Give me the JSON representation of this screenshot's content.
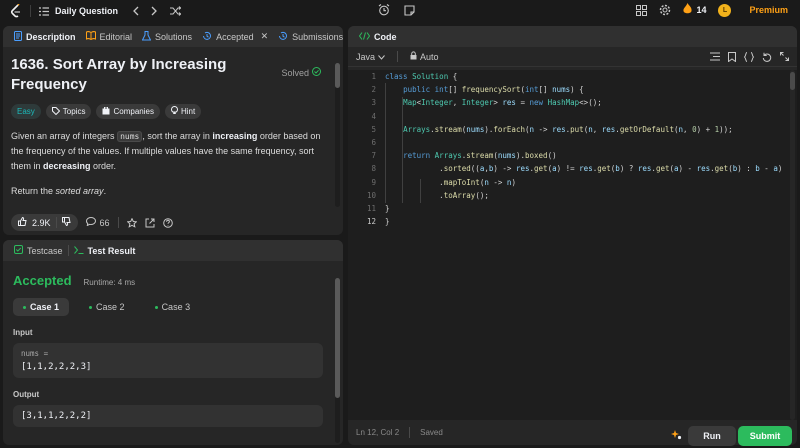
{
  "topbar": {
    "title": "Daily Question",
    "streak": "14",
    "premium": "Premium",
    "coin": "L"
  },
  "desc_tabs": [
    {
      "label": "Description",
      "icon": "description-icon"
    },
    {
      "label": "Editorial",
      "icon": "book-icon"
    },
    {
      "label": "Solutions",
      "icon": "flask-icon"
    },
    {
      "label": "Accepted",
      "icon": "history-icon"
    },
    {
      "label": "Submissions",
      "icon": "history-icon"
    }
  ],
  "problem": {
    "title": "1636. Sort Array by Increasing Frequency",
    "status": "Solved",
    "difficulty": "Easy",
    "tags": [
      "Topics",
      "Companies",
      "Hint"
    ],
    "p1_a": "Given an array of integers ",
    "p1_code": "nums",
    "p1_b": ", sort the array in ",
    "p1_bold1": "increasing",
    "p1_c": " order based on the frequency of the values. If multiple values have the same frequency, sort them in ",
    "p1_bold2": "decreasing",
    "p1_d": " order.",
    "p2_a": "Return the ",
    "p2_i": "sorted array",
    "p2_b": ".",
    "likes": "2.9K",
    "comments": "66"
  },
  "result_tabs": [
    {
      "label": "Testcase"
    },
    {
      "label": "Test Result"
    }
  ],
  "result": {
    "status": "Accepted",
    "runtime": "Runtime: 4 ms",
    "cases": [
      "Case 1",
      "Case 2",
      "Case 3"
    ],
    "input_label": "Input",
    "input_key": "nums =",
    "input_value": "[1,1,2,2,2,3]",
    "output_label": "Output",
    "output_value": "[3,1,1,2,2,2]"
  },
  "code": {
    "tab": "Code",
    "language": "Java",
    "mode": "Auto",
    "status_pos": "Ln 12, Col 2",
    "status_saved": "Saved",
    "run": "Run",
    "submit": "Submit"
  },
  "colors": {
    "accent_green": "#2cbb5d",
    "premium_orange": "#ffa116",
    "easy_teal": "#1cbaba"
  }
}
